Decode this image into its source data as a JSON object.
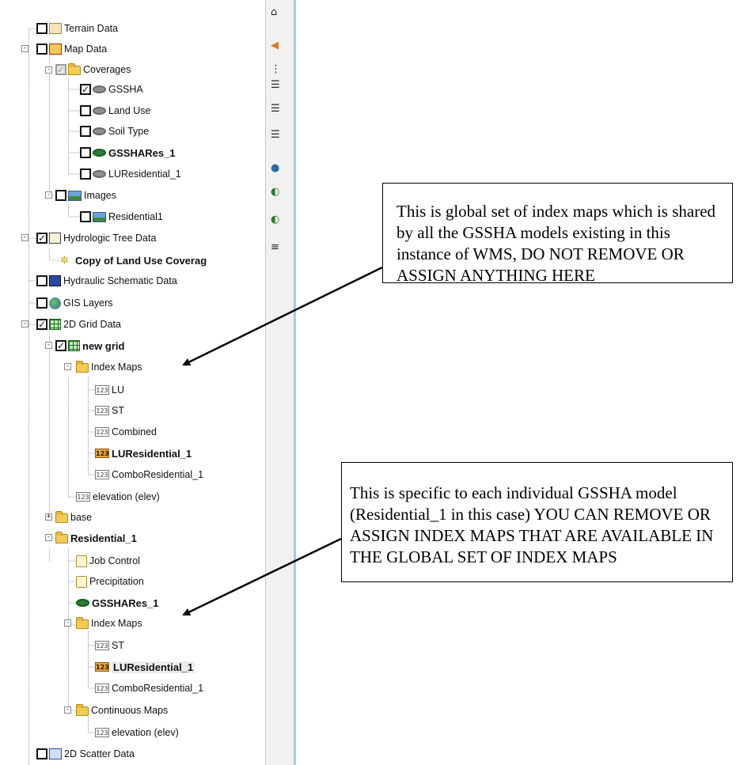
{
  "toolbar": {
    "glyphs": [
      "⌂",
      "◀",
      "⋮",
      "☰",
      "☰",
      "☰",
      "●",
      "◐",
      "◐",
      "≡"
    ]
  },
  "tree": {
    "terrain_data": "Terrain Data",
    "map_data": "Map Data",
    "coverages": "Coverages",
    "cov_gssha": "GSSHA",
    "cov_land_use": "Land Use",
    "cov_soil_type": "Soil Type",
    "cov_gssha_res": "GSSHARes_1",
    "cov_lu_res": "LUResidential_1",
    "images": "Images",
    "img_residential": "Residential1",
    "hydrologic_tree": "Hydrologic Tree Data",
    "copy_land_use": "Copy of Land Use Coverag",
    "hydraulic_schematic": "Hydraulic Schematic Data",
    "gis_layers": "GIS Layers",
    "grid_data": "2D Grid Data",
    "new_grid": "new grid",
    "index_maps": "Index Maps",
    "im_lu": "LU",
    "im_st": "ST",
    "im_combined": "Combined",
    "im_lu_res": "LUResidential_1",
    "im_combo_res": "ComboResidential_1",
    "elevation": "elevation (elev)",
    "base": "base",
    "residential": "Residential_1",
    "job_control": "Job Control",
    "precipitation": "Precipitation",
    "res_gssha": "GSSHARes_1",
    "res_index_maps": "Index Maps",
    "res_im_st": "ST",
    "res_im_lu_res": "LUResidential_1",
    "res_im_combo": "ComboResidential_1",
    "continuous_maps": "Continuous Maps",
    "cont_elevation": "elevation (elev)",
    "scatter_data": "2D Scatter Data",
    "icon_123": "123"
  },
  "callouts": {
    "global": "This is global set of index maps which is shared by all the GSSHA models existing in this instance of WMS, DO NOT REMOVE OR ASSIGN ANYTHING HERE",
    "specific": "This is specific to each individual GSSHA model (Residential_1 in this case) YOU CAN REMOVE OR ASSIGN INDEX MAPS THAT ARE AVAILABLE IN THE GLOBAL SET OF INDEX MAPS"
  }
}
